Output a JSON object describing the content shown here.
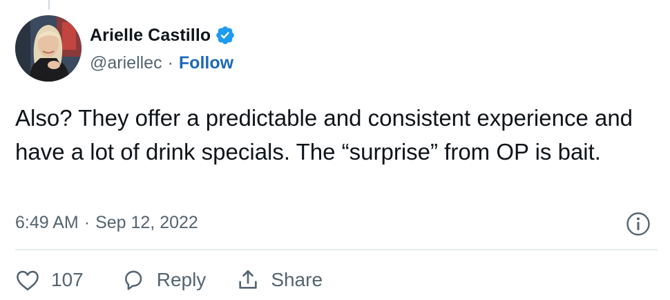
{
  "author": {
    "display_name": "Arielle Castillo",
    "handle": "@ariellec",
    "separator": "·",
    "follow_label": "Follow",
    "verified": true
  },
  "tweet": {
    "text": "Also? They offer a predictable and consistent experience and have a lot of drink specials. The “surprise” from OP is bait.",
    "time": "6:49 AM",
    "date_separator": "·",
    "date": "Sep 12, 2022"
  },
  "actions": {
    "like_count": "107",
    "reply_label": "Reply",
    "share_label": "Share"
  },
  "colors": {
    "text": "#0f1419",
    "secondary": "#536471",
    "link": "#1d68b8",
    "verified": "#1d9bf0",
    "divider": "#cfd9de"
  },
  "icons": [
    "verified-badge-icon",
    "info-icon",
    "heart-icon",
    "reply-bubble-icon",
    "share-icon"
  ]
}
